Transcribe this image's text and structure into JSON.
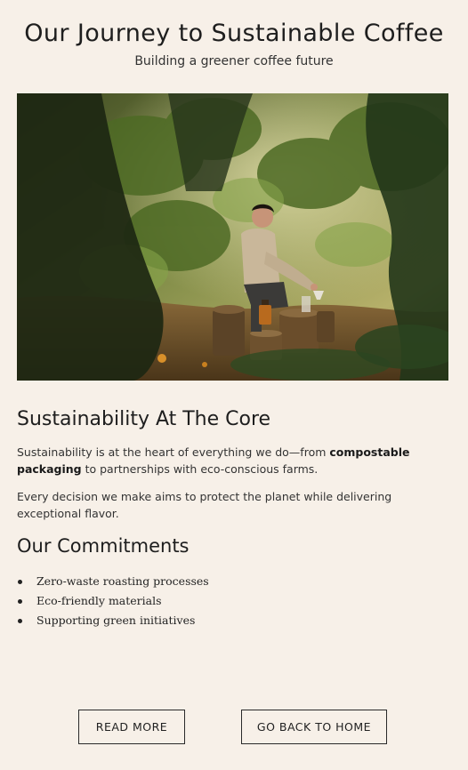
{
  "header": {
    "title": "Our Journey to Sustainable Coffee",
    "subtitle": "Building a greener coffee future"
  },
  "hero_image": {
    "alt": "Man brewing coffee outdoors among forest greenery"
  },
  "section_core": {
    "heading": "Sustainability At The Core",
    "p1_before": "Sustainability is at the heart of everything we do—from ",
    "p1_bold": "compostable packaging",
    "p1_after": " to partnerships with eco-conscious farms.",
    "p2": "Every decision we make aims to protect the planet while delivering exceptional flavor."
  },
  "section_commitments": {
    "heading": "Our Commitments",
    "items": [
      "Zero-waste roasting processes",
      "Eco-friendly materials",
      "Supporting green initiatives"
    ]
  },
  "buttons": {
    "read_more": "READ MORE",
    "back_home": "GO BACK TO HOME"
  },
  "colors": {
    "background": "#f7f0e8",
    "text": "#1f1f1f",
    "button_border": "#2a2a2a"
  }
}
